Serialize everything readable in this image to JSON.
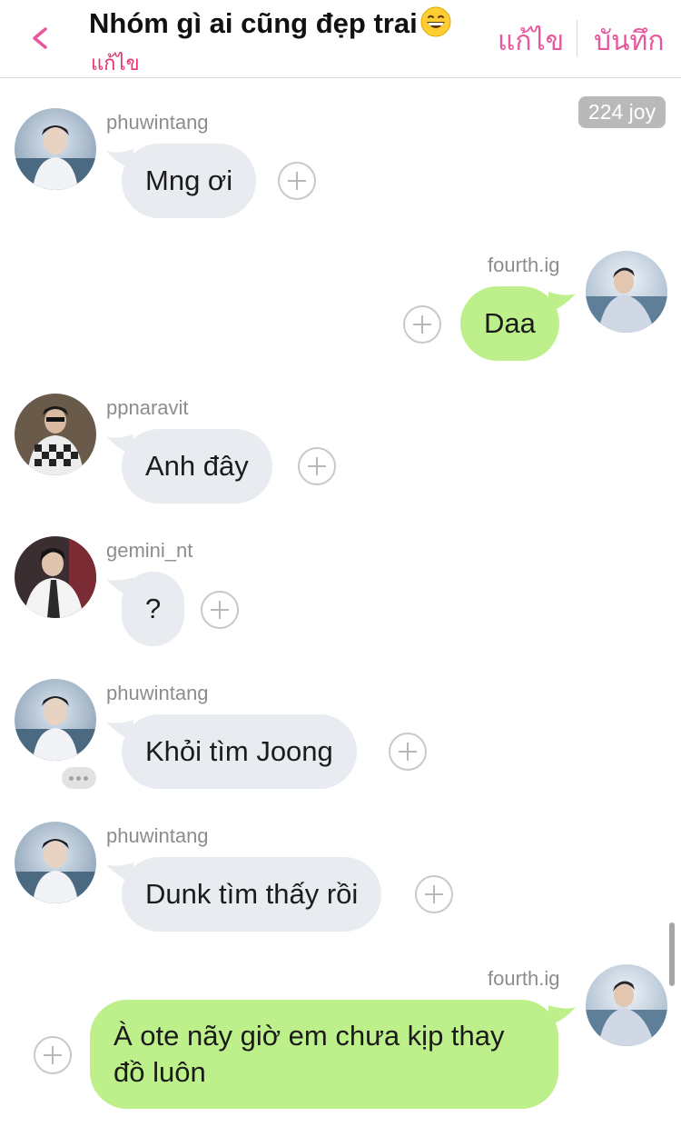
{
  "header": {
    "title": "Nhóm gì ai cũng đẹp trai",
    "title_emoji": "grinning-face-emoji",
    "subtitle": "แก้ไข",
    "edit_label": "แก้ไข",
    "save_label": "บันทึก",
    "back_icon": "chevron-left-icon"
  },
  "joy_badge": "224 joy",
  "messages": [
    {
      "sender": "phuwintang",
      "direction": "incoming",
      "text": "Mng ơi"
    },
    {
      "sender": "fourth.ig",
      "direction": "outgoing",
      "text": "Daa"
    },
    {
      "sender": "ppnaravit",
      "direction": "incoming",
      "text": "Anh đây"
    },
    {
      "sender": "gemini_nt",
      "direction": "incoming",
      "text": "?"
    },
    {
      "sender": "phuwintang",
      "direction": "incoming",
      "text": "Khỏi tìm Joong"
    },
    {
      "sender": "phuwintang",
      "direction": "incoming",
      "text": "Dunk tìm thấy rồi"
    },
    {
      "sender": "fourth.ig",
      "direction": "outgoing",
      "text": "À ote nãy giờ em chưa kịp thay đồ luôn"
    }
  ],
  "colors": {
    "accent_pink": "#e8579b",
    "subtitle_red": "#e8356b",
    "incoming_bubble": "#e8ebef",
    "outgoing_bubble": "#bdf08a",
    "joy_badge": "#b9b9b9"
  }
}
